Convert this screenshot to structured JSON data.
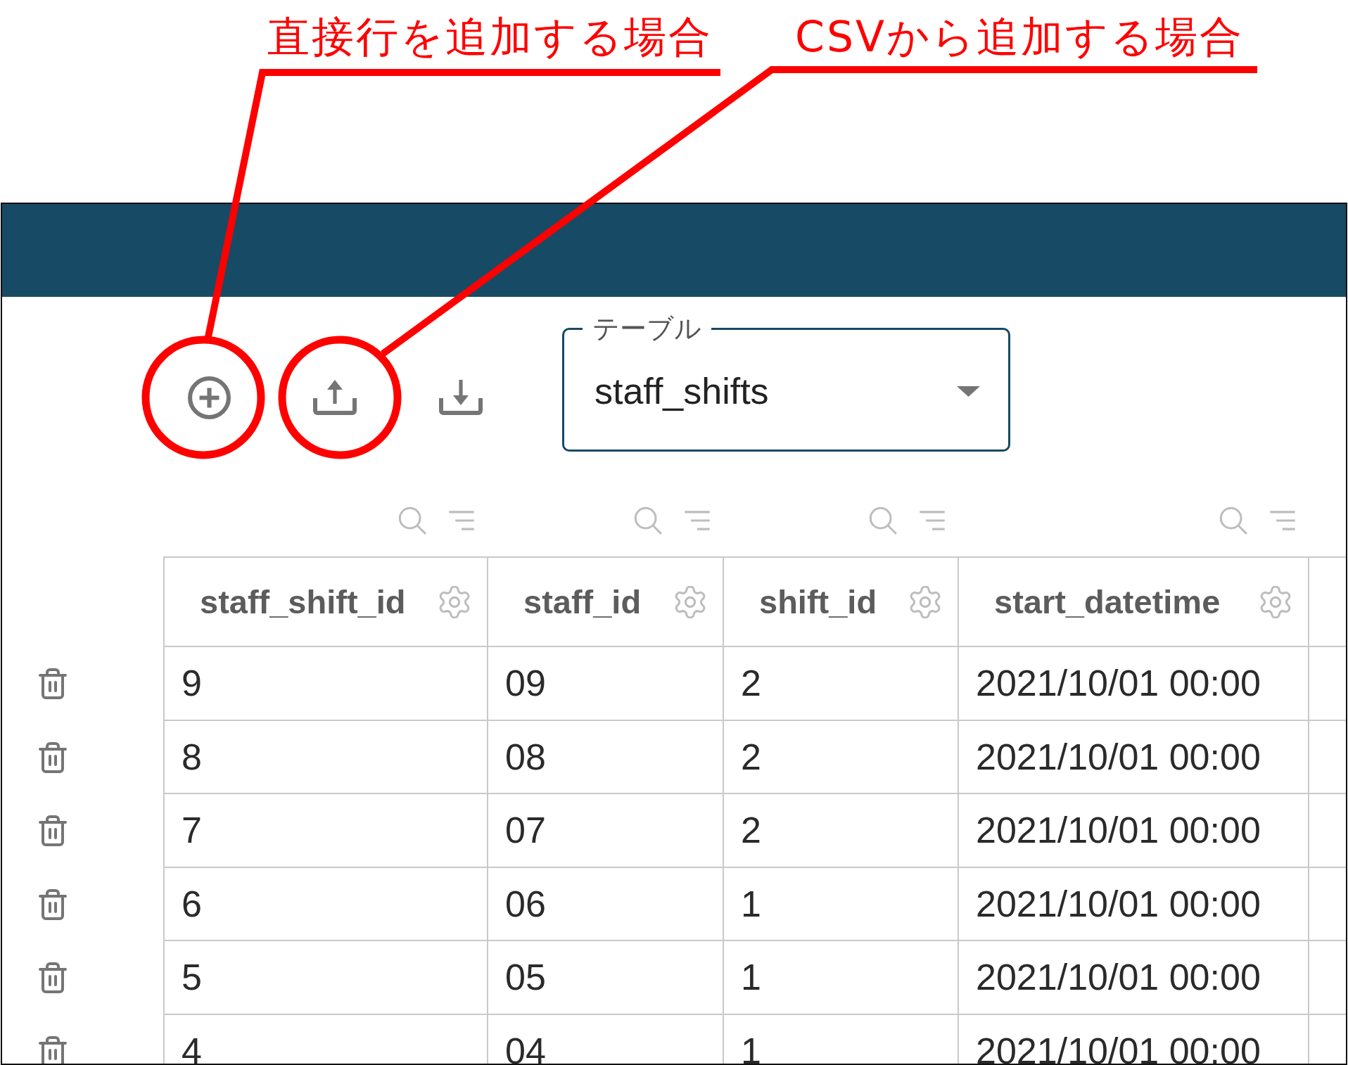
{
  "annotations": [
    {
      "text": "直接行を追加する場合"
    },
    {
      "text": "CSVから追加する場合"
    }
  ],
  "table_select": {
    "label": "テーブル",
    "value": "staff_shifts"
  },
  "table": {
    "columns": [
      {
        "title": "staff_shift_id"
      },
      {
        "title": "staff_id"
      },
      {
        "title": "shift_id"
      },
      {
        "title": "start_datetime"
      }
    ],
    "rows": [
      {
        "cells": [
          "9",
          "09",
          "2",
          "2021/10/01 00:00"
        ]
      },
      {
        "cells": [
          "8",
          "08",
          "2",
          "2021/10/01 00:00"
        ]
      },
      {
        "cells": [
          "7",
          "07",
          "2",
          "2021/10/01 00:00"
        ]
      },
      {
        "cells": [
          "6",
          "06",
          "1",
          "2021/10/01 00:00"
        ]
      },
      {
        "cells": [
          "5",
          "05",
          "1",
          "2021/10/01 00:00"
        ]
      },
      {
        "cells": [
          "4",
          "04",
          "1",
          "2021/10/01 00:00"
        ]
      }
    ]
  }
}
